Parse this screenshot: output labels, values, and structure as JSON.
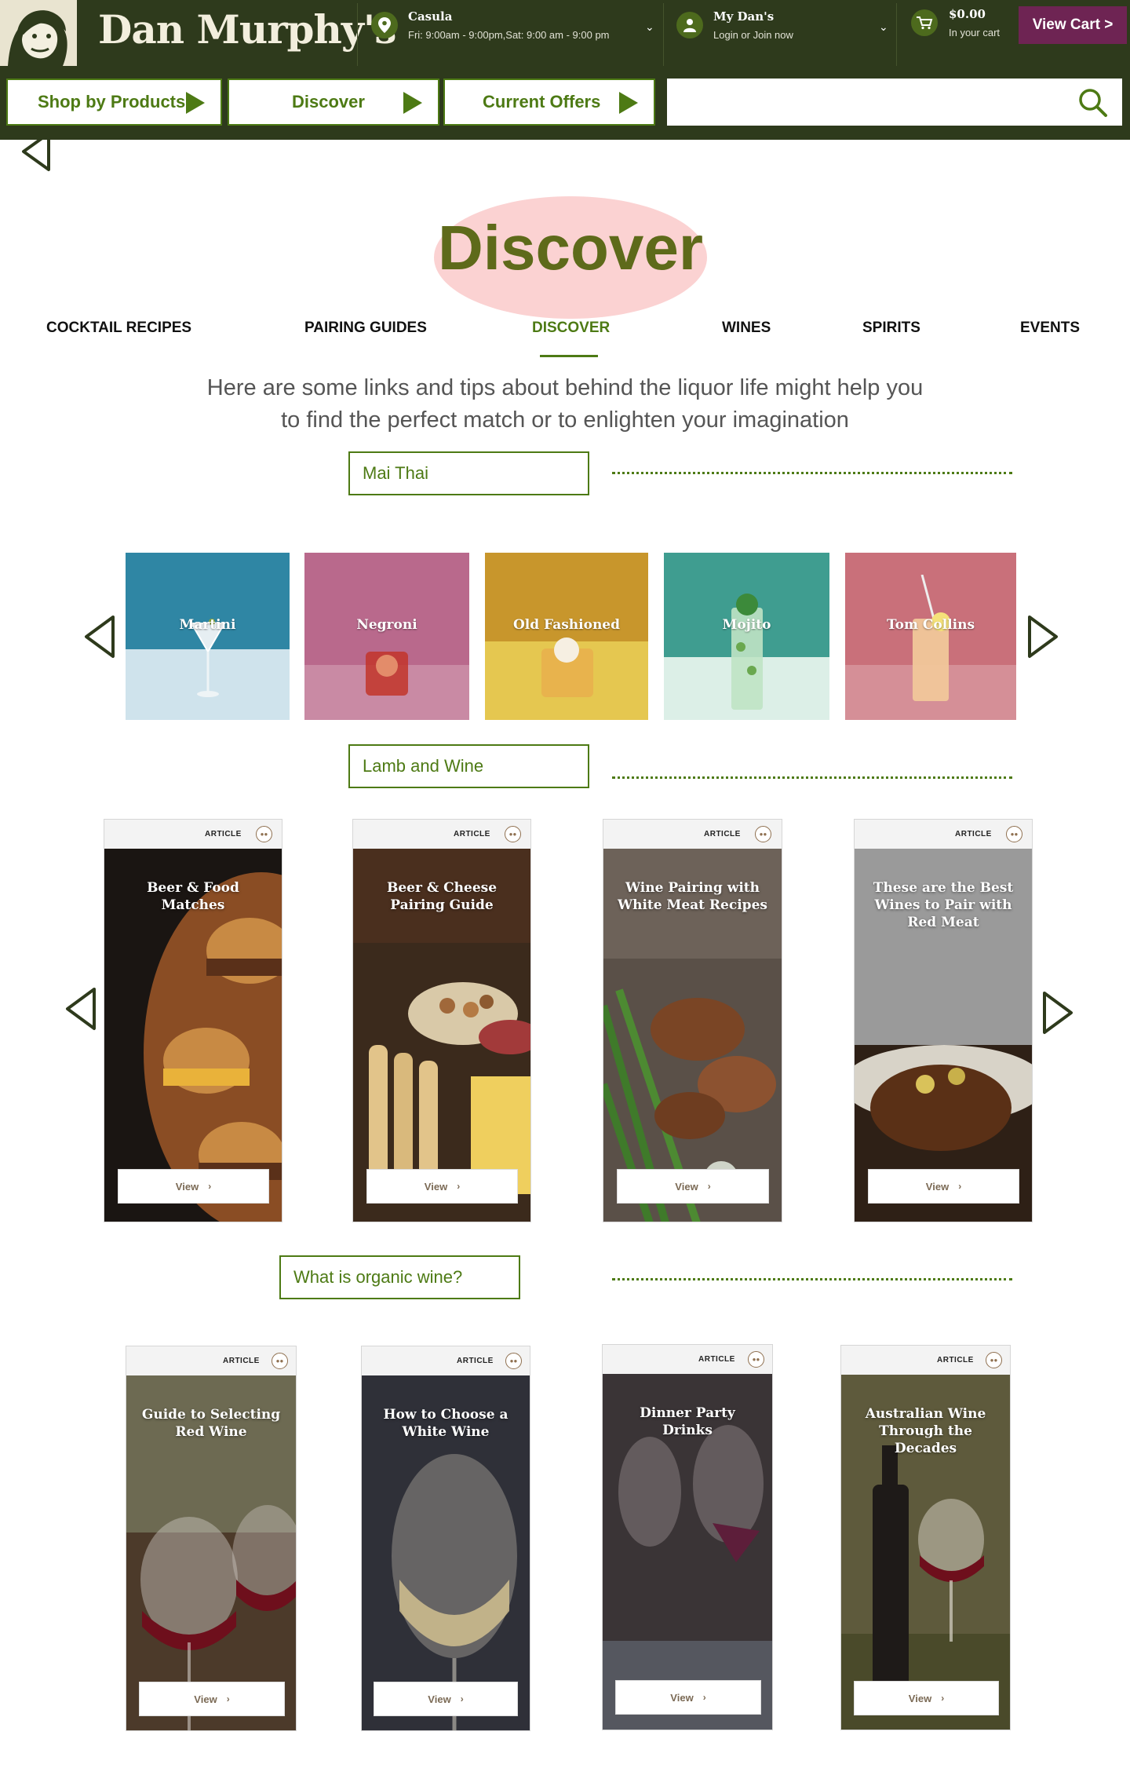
{
  "header": {
    "brand": "Dan Murphy's",
    "store": {
      "name": "Casula",
      "hours": "Fri: 9:00am - 9:00pm,Sat: 9:00 am - 9:00 pm"
    },
    "account": {
      "title": "My Dan's",
      "subtitle": "Login or Join now"
    },
    "cart": {
      "amount": "$0.00",
      "subtitle": "In your cart",
      "button": "View Cart >"
    },
    "nav": [
      "Shop by Products",
      "Discover",
      "Current Offers"
    ],
    "search_placeholder": ""
  },
  "page": {
    "title": "Discover",
    "tabs": [
      "COCKTAIL RECIPES",
      "PAIRING GUIDES",
      "DISCOVER",
      "WINES",
      "SPIRITS",
      "EVENTS"
    ],
    "active_tab": "DISCOVER",
    "intro_line1": "Here are some links and tips about behind the liquor life might help you",
    "intro_line2": "to find the perfect match or to enlighten your imagination"
  },
  "sections": [
    {
      "heading": "Mai Thai",
      "kind": "cocktails",
      "items": [
        {
          "name": "Martini",
          "bg": "#2f86a4"
        },
        {
          "name": "Negroni",
          "bg": "#b9698c"
        },
        {
          "name": "Old Fashioned",
          "bg": "#c8962c"
        },
        {
          "name": "Mojito",
          "bg": "#3f9d90"
        },
        {
          "name": "Tom Collins",
          "bg": "#c9707a"
        }
      ]
    },
    {
      "heading": "Lamb and Wine",
      "kind": "articles",
      "tag": "ARTICLE",
      "view_label": "View",
      "items": [
        {
          "title": "Beer & Food Matches"
        },
        {
          "title": "Beer & Cheese Pairing Guide"
        },
        {
          "title": "Wine Pairing with White Meat Recipes"
        },
        {
          "title": "These are the Best Wines to Pair with Red Meat"
        }
      ]
    },
    {
      "heading": "What is organic wine?",
      "kind": "articles",
      "tag": "ARTICLE",
      "view_label": "View",
      "items": [
        {
          "title": "Guide to Selecting Red Wine"
        },
        {
          "title": "How to Choose a White Wine"
        },
        {
          "title": "Dinner Party Drinks"
        },
        {
          "title": "Australian Wine Through the Decades"
        }
      ]
    }
  ],
  "colors": {
    "brand_green": "#4d7a14",
    "header_bg": "#2e3a1c",
    "cart_button": "#6e2453",
    "hero_highlight": "#fbd2d2"
  }
}
